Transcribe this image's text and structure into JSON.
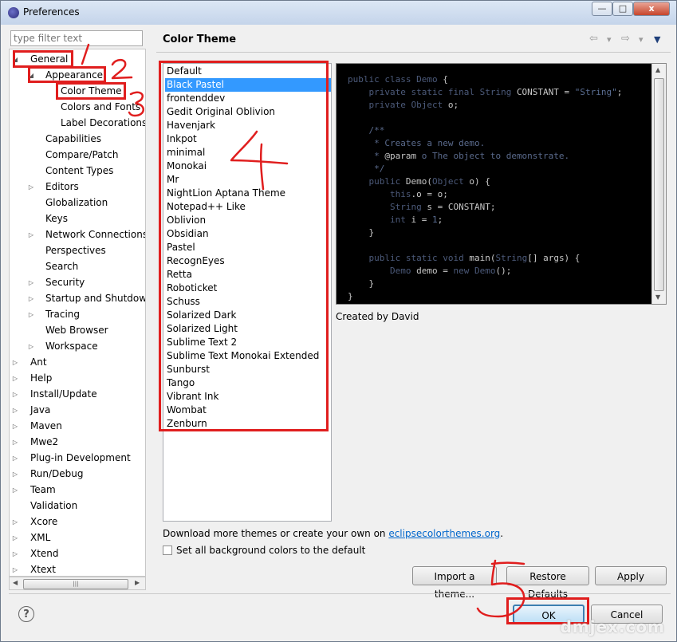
{
  "window": {
    "title": "Preferences",
    "controls": {
      "minimize": "—",
      "maximize": "□",
      "close": "x"
    }
  },
  "filter": {
    "placeholder": "type filter text"
  },
  "tree": [
    {
      "label": "General",
      "level": 0,
      "state": "expanded"
    },
    {
      "label": "Appearance",
      "level": 1,
      "state": "expanded"
    },
    {
      "label": "Color Theme",
      "level": 2,
      "state": "none",
      "selected": true
    },
    {
      "label": "Colors and Fonts",
      "level": 2,
      "state": "none"
    },
    {
      "label": "Label Decorations",
      "level": 2,
      "state": "none"
    },
    {
      "label": "Capabilities",
      "level": 1,
      "state": "none"
    },
    {
      "label": "Compare/Patch",
      "level": 1,
      "state": "none"
    },
    {
      "label": "Content Types",
      "level": 1,
      "state": "none"
    },
    {
      "label": "Editors",
      "level": 1,
      "state": "collapsed"
    },
    {
      "label": "Globalization",
      "level": 1,
      "state": "none"
    },
    {
      "label": "Keys",
      "level": 1,
      "state": "none"
    },
    {
      "label": "Network Connections",
      "level": 1,
      "state": "collapsed"
    },
    {
      "label": "Perspectives",
      "level": 1,
      "state": "none"
    },
    {
      "label": "Search",
      "level": 1,
      "state": "none"
    },
    {
      "label": "Security",
      "level": 1,
      "state": "collapsed"
    },
    {
      "label": "Startup and Shutdown",
      "level": 1,
      "state": "collapsed"
    },
    {
      "label": "Tracing",
      "level": 1,
      "state": "collapsed"
    },
    {
      "label": "Web Browser",
      "level": 1,
      "state": "none"
    },
    {
      "label": "Workspace",
      "level": 1,
      "state": "collapsed"
    },
    {
      "label": "Ant",
      "level": 0,
      "state": "collapsed"
    },
    {
      "label": "Help",
      "level": 0,
      "state": "collapsed"
    },
    {
      "label": "Install/Update",
      "level": 0,
      "state": "collapsed"
    },
    {
      "label": "Java",
      "level": 0,
      "state": "collapsed"
    },
    {
      "label": "Maven",
      "level": 0,
      "state": "collapsed"
    },
    {
      "label": "Mwe2",
      "level": 0,
      "state": "collapsed"
    },
    {
      "label": "Plug-in Development",
      "level": 0,
      "state": "collapsed"
    },
    {
      "label": "Run/Debug",
      "level": 0,
      "state": "collapsed"
    },
    {
      "label": "Team",
      "level": 0,
      "state": "collapsed"
    },
    {
      "label": "Validation",
      "level": 0,
      "state": "none"
    },
    {
      "label": "Xcore",
      "level": 0,
      "state": "collapsed"
    },
    {
      "label": "XML",
      "level": 0,
      "state": "collapsed"
    },
    {
      "label": "Xtend",
      "level": 0,
      "state": "collapsed"
    },
    {
      "label": "Xtext",
      "level": 0,
      "state": "collapsed"
    }
  ],
  "page": {
    "title": "Color Theme",
    "nav": {
      "back": "⇦",
      "back_menu": "▾",
      "forward": "⇨",
      "forward_menu": "▾",
      "view_menu": "▼"
    }
  },
  "themes": [
    "Default",
    "Black Pastel",
    "frontenddev",
    "Gedit Original Oblivion",
    "Havenjark",
    "Inkpot",
    "minimal",
    "Monokai",
    "Mr",
    "NightLion Aptana Theme",
    "Notepad++ Like",
    "Oblivion",
    "Obsidian",
    "Pastel",
    "RecognEyes",
    "Retta",
    "Roboticket",
    "Schuss",
    "Solarized Dark",
    "Solarized Light",
    "Sublime Text 2",
    "Sublime Text Monokai Extended",
    "Sunburst",
    "Tango",
    "Vibrant Ink",
    "Wombat",
    "Zenburn"
  ],
  "selected_theme": "Black Pastel",
  "preview": {
    "lines": [
      [
        [
          "kw",
          "public class "
        ],
        [
          "kw",
          "Demo"
        ],
        [
          "plain",
          " {"
        ]
      ],
      [
        [
          "kw",
          "    private static final "
        ],
        [
          "kw",
          "String "
        ],
        [
          "plain",
          "CONSTANT"
        ],
        [
          "plain",
          " = "
        ],
        [
          "str",
          "\"String\""
        ],
        [
          "plain",
          ";"
        ]
      ],
      [
        [
          "kw",
          "    private "
        ],
        [
          "kw",
          "Object "
        ],
        [
          "plain",
          "o;"
        ]
      ],
      [
        [
          "plain",
          ""
        ]
      ],
      [
        [
          "cm",
          "    /**"
        ]
      ],
      [
        [
          "cm",
          "     * Creates a new demo."
        ]
      ],
      [
        [
          "cm",
          "     * "
        ],
        [
          "plain",
          "@param"
        ],
        [
          "cm",
          " o The object to demonstrate."
        ]
      ],
      [
        [
          "cm",
          "     */"
        ]
      ],
      [
        [
          "kw",
          "    public "
        ],
        [
          "plain",
          "Demo("
        ],
        [
          "kw",
          "Object "
        ],
        [
          "plain",
          "o) {"
        ]
      ],
      [
        [
          "kw",
          "        this"
        ],
        [
          "plain",
          ".o = o;"
        ]
      ],
      [
        [
          "kw",
          "        String "
        ],
        [
          "plain",
          "s = CONSTANT;"
        ]
      ],
      [
        [
          "kw",
          "        int "
        ],
        [
          "plain",
          "i = "
        ],
        [
          "str",
          "1"
        ],
        [
          "plain",
          ";"
        ]
      ],
      [
        [
          "plain",
          "    }"
        ]
      ],
      [
        [
          "plain",
          ""
        ]
      ],
      [
        [
          "kw",
          "    public static void "
        ],
        [
          "plain",
          "main("
        ],
        [
          "kw",
          "String"
        ],
        [
          "plain",
          "[] args) {"
        ]
      ],
      [
        [
          "kw",
          "        Demo "
        ],
        [
          "plain",
          "demo = "
        ],
        [
          "kw",
          "new "
        ],
        [
          "kw",
          "Demo"
        ],
        [
          "plain",
          "();"
        ]
      ],
      [
        [
          "plain",
          "    }"
        ]
      ],
      [
        [
          "plain",
          "}"
        ]
      ]
    ]
  },
  "author": "Created by David",
  "download": {
    "text": "Download more themes or create your own on ",
    "link": "eclipsecolorthemes.org",
    "suffix": "."
  },
  "checkbox": {
    "label": "Set all background colors to the default",
    "checked": false
  },
  "buttons": {
    "import": "Import a theme...",
    "restore": "Restore Defaults",
    "apply": "Apply",
    "ok": "OK",
    "cancel": "Cancel"
  },
  "help_label": "?",
  "annotations": [
    "1",
    "2",
    "3",
    "4",
    "5"
  ],
  "watermark": "dmjex.com",
  "colors": {
    "annotation": "#e01e1e",
    "selection": "#3399ff",
    "link": "#0066cc",
    "preview_bg": "#000000"
  }
}
